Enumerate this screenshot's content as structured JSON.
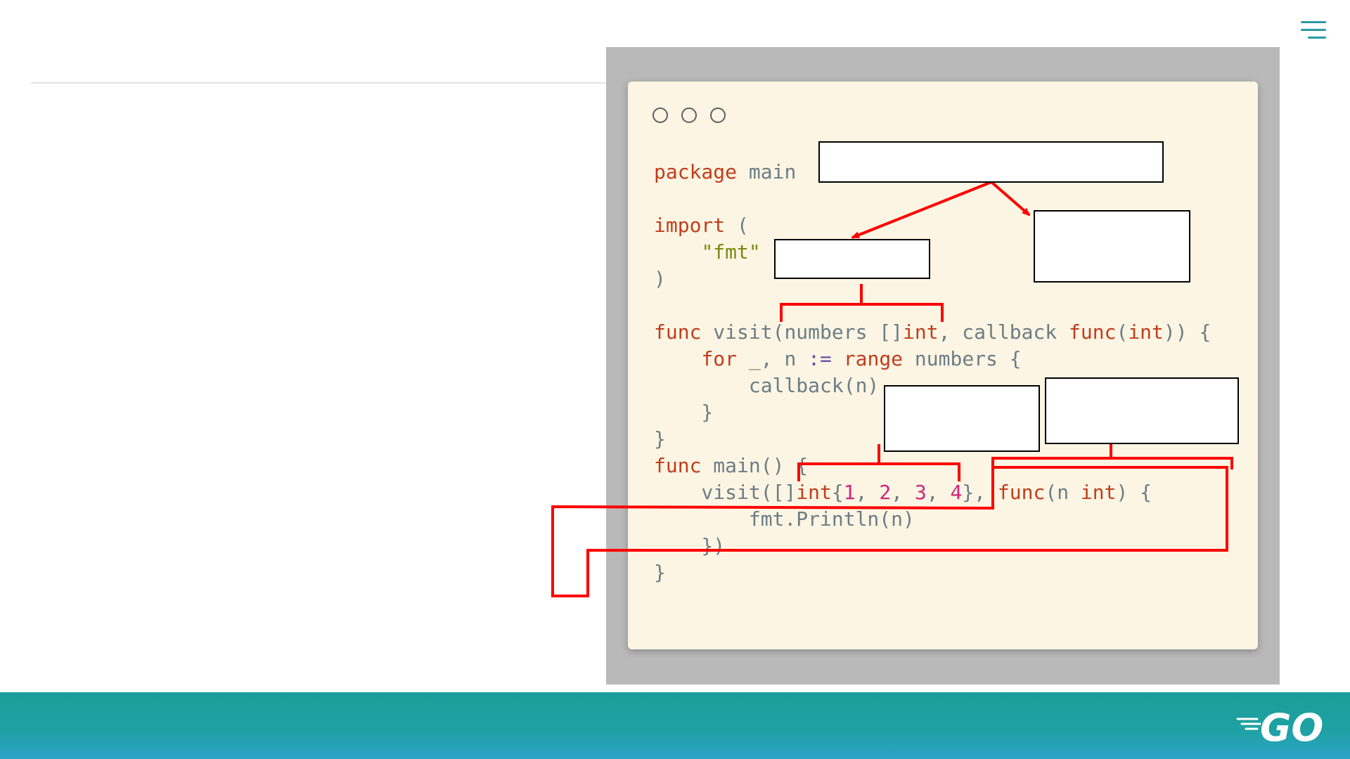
{
  "menu": {
    "icon": "hamburger-menu-icon",
    "accent": "#2b9aa6"
  },
  "code": {
    "window_dots": [
      "window-dot-1",
      "window-dot-2",
      "window-dot-3"
    ],
    "colors": {
      "keyword": "#c13d1c",
      "string": "#7a8a10",
      "number": "#d0247c",
      "plain": "#6b7d86",
      "background": "#fcf5e3"
    },
    "tokens": {
      "l1_kw": "package",
      "l1_rest": " main",
      "l3_kw": "import",
      "l3_rest": " (",
      "l4_ind": "    ",
      "l4_str": "\"fmt\"",
      "l5": ")",
      "l7_kw": "func",
      "l7_a": " visit(numbers []",
      "l7_int": "int",
      "l7_b": ", callback ",
      "l7_func": "func",
      "l7_c": "(",
      "l7_int2": "int",
      "l7_d": ")) {",
      "l8_ind": "    ",
      "l8_for": "for",
      "l8_a": " _, n ",
      "l8_op": ":=",
      "l8_sp": " ",
      "l8_range": "range",
      "l8_b": " numbers {",
      "l9": "        callback(n)",
      "l10": "    }",
      "l11": "}",
      "l12_kw": "func",
      "l12_rest": " main() {",
      "l13_a": "    visit([]",
      "l13_int": "int",
      "l13_b": "{",
      "n1": "1",
      "c1": ", ",
      "n2": "2",
      "c2": ", ",
      "n3": "3",
      "c3": ", ",
      "n4": "4",
      "l13_c": "}, ",
      "l13_func": "func",
      "l13_d": "(n ",
      "l13_int2": "int",
      "l13_e": ") {",
      "l14": "        fmt.Println(n)",
      "l15": "    })",
      "l16": "}"
    }
  },
  "annotations": {
    "color": "#ff0000",
    "labels": [
      "label-box-top",
      "label-box-left",
      "label-box-right",
      "label-box-middle",
      "label-box-far-right"
    ]
  },
  "footer": {
    "logo": "go-logo",
    "logo_text": "GO",
    "colors": [
      "#1c9e9a",
      "#2ea3c8"
    ]
  }
}
